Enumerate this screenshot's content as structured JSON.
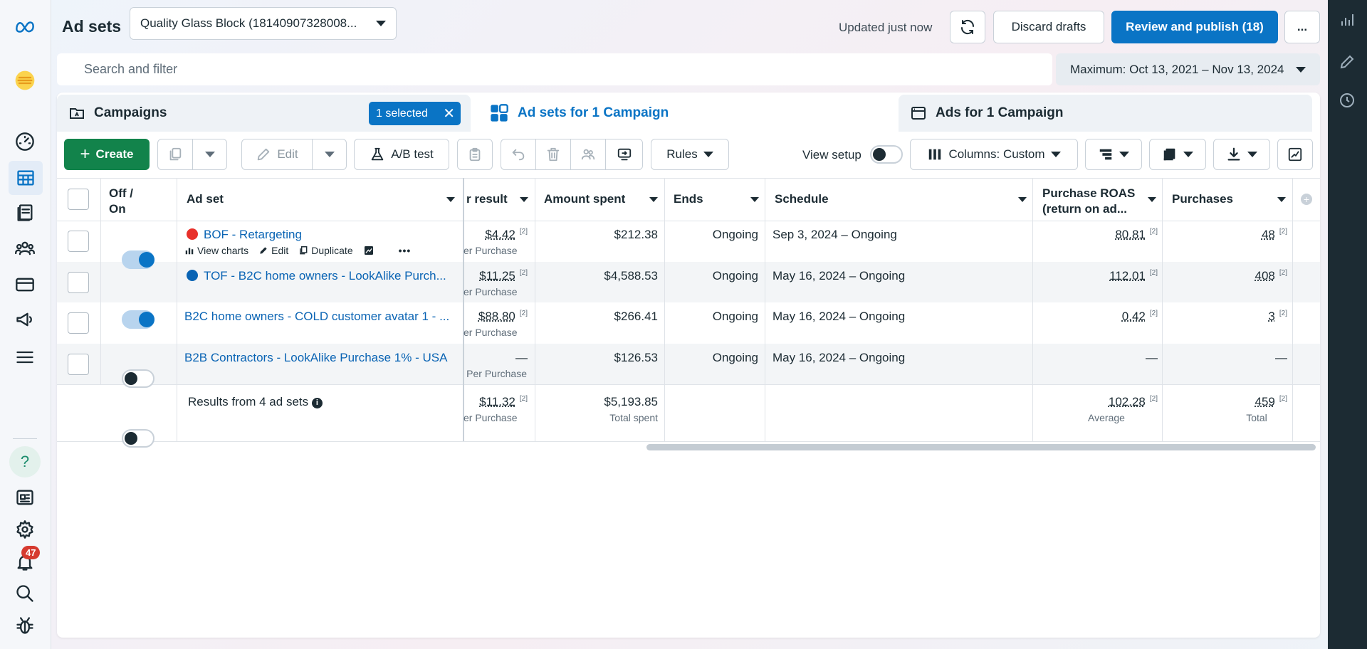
{
  "header": {
    "title": "Ad sets",
    "account": "Quality Glass Block (18140907328008...",
    "updated": "Updated just now",
    "discard": "Discard drafts",
    "review_publish": "Review and publish (18)",
    "more": "..."
  },
  "search": {
    "placeholder": "Search and filter"
  },
  "date_range": "Maximum: Oct 13, 2021 – Nov 13, 2024",
  "tabs": {
    "campaigns": "Campaigns",
    "selected": "1 selected",
    "adsets": "Ad sets for 1 Campaign",
    "ads": "Ads for 1 Campaign"
  },
  "toolbar": {
    "create": "Create",
    "edit": "Edit",
    "ab_test": "A/B test",
    "rules": "Rules",
    "view_setup": "View setup",
    "columns": "Columns: Custom"
  },
  "columns": {
    "off_on_1": "Off /",
    "off_on_2": "On",
    "adset": "Ad set",
    "cost_per_result": "r result",
    "amount_spent": "Amount spent",
    "ends": "Ends",
    "schedule": "Schedule",
    "roas_1": "Purchase ROAS",
    "roas_2": "(return on ad...",
    "purchases": "Purchases"
  },
  "rows": [
    {
      "name": "BOF - Retargeting",
      "dot": "#e8302a",
      "on": true,
      "cpr": "$4.42",
      "cpr_sub": "er Purchase",
      "spent": "$212.38",
      "ends": "Ongoing",
      "schedule": "Sep 3, 2024 – Ongoing",
      "roas": "80.81",
      "purchases": "48"
    },
    {
      "name": "TOF - B2C home owners - LookAlike Purch...",
      "dot": "#0a64b4",
      "on": true,
      "cpr": "$11.25",
      "cpr_sub": "er Purchase",
      "spent": "$4,588.53",
      "ends": "Ongoing",
      "schedule": "May 16, 2024 – Ongoing",
      "roas": "112.01",
      "purchases": "408"
    },
    {
      "name": "B2C home owners - COLD customer avatar 1 - ...",
      "dot": "",
      "on": false,
      "cpr": "$88.80",
      "cpr_sub": "er Purchase",
      "spent": "$266.41",
      "ends": "Ongoing",
      "schedule": "May 16, 2024 – Ongoing",
      "roas": "0.42",
      "purchases": "3"
    },
    {
      "name": "B2B Contractors - LookAlike Purchase 1% - USA",
      "dot": "",
      "on": false,
      "cpr": "—",
      "cpr_sub": "Per Purchase",
      "spent": "$126.53",
      "ends": "Ongoing",
      "schedule": "May 16, 2024 – Ongoing",
      "roas": "—",
      "purchases": "—"
    }
  ],
  "sup": "[2]",
  "row_actions": {
    "view_charts": "View charts",
    "edit": "Edit",
    "duplicate": "Duplicate"
  },
  "totals": {
    "label": "Results from 4 ad sets",
    "cpr": "$11.32",
    "cpr_sub": "er Purchase",
    "spent": "$5,193.85",
    "spent_sub": "Total spent",
    "roas": "102.28",
    "roas_sub": "Average",
    "purchases": "459",
    "purchases_sub": "Total"
  },
  "notifications": {
    "count": "47"
  },
  "help": "?"
}
